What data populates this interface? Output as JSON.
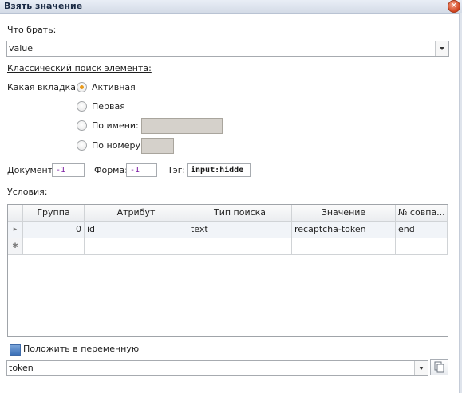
{
  "window": {
    "title": "Взять значение"
  },
  "what_to_take": {
    "label": "Что брать:",
    "value": "value"
  },
  "classic_search": {
    "title": "Классический поиск элемента:"
  },
  "tab_selection": {
    "label": "Какая вкладка:",
    "options": [
      {
        "label": "Активная",
        "selected": true
      },
      {
        "label": "Первая",
        "selected": false
      },
      {
        "label": "По имени:",
        "selected": false
      },
      {
        "label": "По номеру:",
        "selected": false
      }
    ]
  },
  "document": {
    "label": "Документ:",
    "value": "-1"
  },
  "form": {
    "label": "Форма:",
    "value": "-1"
  },
  "tag": {
    "label": "Тэг:",
    "value": "input:hidde"
  },
  "conditions": {
    "label": "Условия:",
    "columns": [
      "Группа",
      "Атрибут",
      "Тип поиска",
      "Значение",
      "№ совпа..."
    ],
    "rows": [
      {
        "selector": "▸",
        "group": "0",
        "attribute": "id",
        "search_type": "text",
        "value": "recaptcha-token",
        "match_no": "end"
      },
      {
        "selector": "✱",
        "group": "",
        "attribute": "",
        "search_type": "",
        "value": "",
        "match_no": ""
      }
    ]
  },
  "save_to_variable": {
    "label": "Положить в переменную",
    "value": "token"
  },
  "colors": {
    "title_text": "#1a2a44",
    "radio_selected": "#e89a1c",
    "close": "#d2431e",
    "disabled_box": "#d5d1cb"
  }
}
